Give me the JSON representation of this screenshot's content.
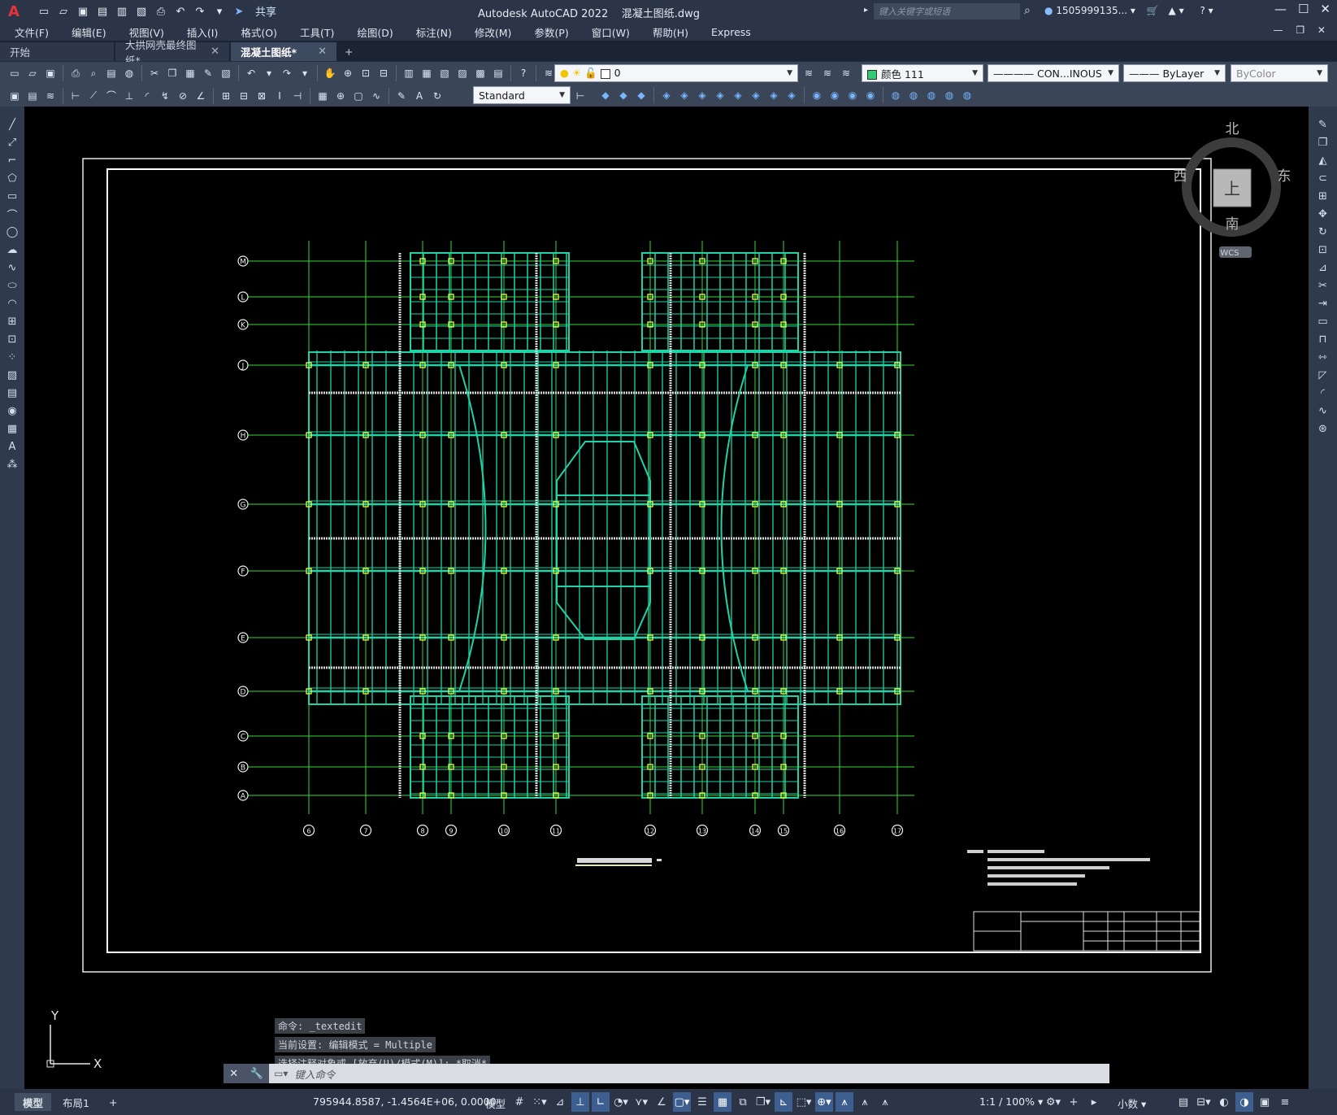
{
  "app": {
    "title": "Autodesk AutoCAD 2022",
    "filename": "混凝土图纸.dwg",
    "logo": "A",
    "share_label": "共享",
    "search_placeholder": "键入关键字或短语",
    "user": "1505999135...",
    "window_controls": [
      "—",
      "☐",
      "✕"
    ]
  },
  "menu": {
    "items": [
      "文件(F)",
      "编辑(E)",
      "视图(V)",
      "插入(I)",
      "格式(O)",
      "工具(T)",
      "绘图(D)",
      "标注(N)",
      "修改(M)",
      "参数(P)",
      "窗口(W)",
      "帮助(H)",
      "Express"
    ],
    "mdi_controls": "— ❐ ✕"
  },
  "tabs": [
    {
      "label": "开始",
      "active": false,
      "closable": false
    },
    {
      "label": "大拱网壳最终图纸*",
      "active": false,
      "closable": true
    },
    {
      "label": "混凝土图纸*",
      "active": true,
      "closable": true
    }
  ],
  "toolbar": {
    "layer_value": "0",
    "color_value": "颜色 111",
    "color_hex": "#2ecc71",
    "linetype_value": "CON...INOUS",
    "lineweight_value": "ByLayer",
    "plotstyle_value": "ByColor",
    "textstyle_value": "Standard"
  },
  "viewcube": {
    "north": "北",
    "south": "南",
    "east": "东",
    "west": "西",
    "face": "上",
    "wcs": "WCS"
  },
  "drawing": {
    "row_labels": [
      "M",
      "L",
      "K",
      "J",
      "H",
      "G",
      "F",
      "E",
      "D",
      "C",
      "B",
      "A"
    ],
    "column_labels": [
      "6",
      "7",
      "8",
      "9",
      "10",
      "11",
      "12",
      "13",
      "14",
      "15",
      "16",
      "17"
    ],
    "line_color": "#1fd3a6",
    "grid_color": "#33dd33",
    "node_color": "#e8ff3a"
  },
  "command": {
    "history": [
      "命令: _textedit",
      "当前设置: 编辑模式 = Multiple",
      "选择注释对象或 [放弃(U)/模式(M)]: *取消*"
    ],
    "prompt_placeholder": "键入命令"
  },
  "ucs": {
    "x": "X",
    "y": "Y"
  },
  "status": {
    "layout_tabs": [
      {
        "label": "模型",
        "active": true
      },
      {
        "label": "布局1",
        "active": false
      },
      {
        "label": "+",
        "active": false
      }
    ],
    "coordinates": "795944.8587, -1.4564E+06, 0.0000",
    "mode": "模型",
    "scale": "1:1 / 100%",
    "units": "小数"
  }
}
